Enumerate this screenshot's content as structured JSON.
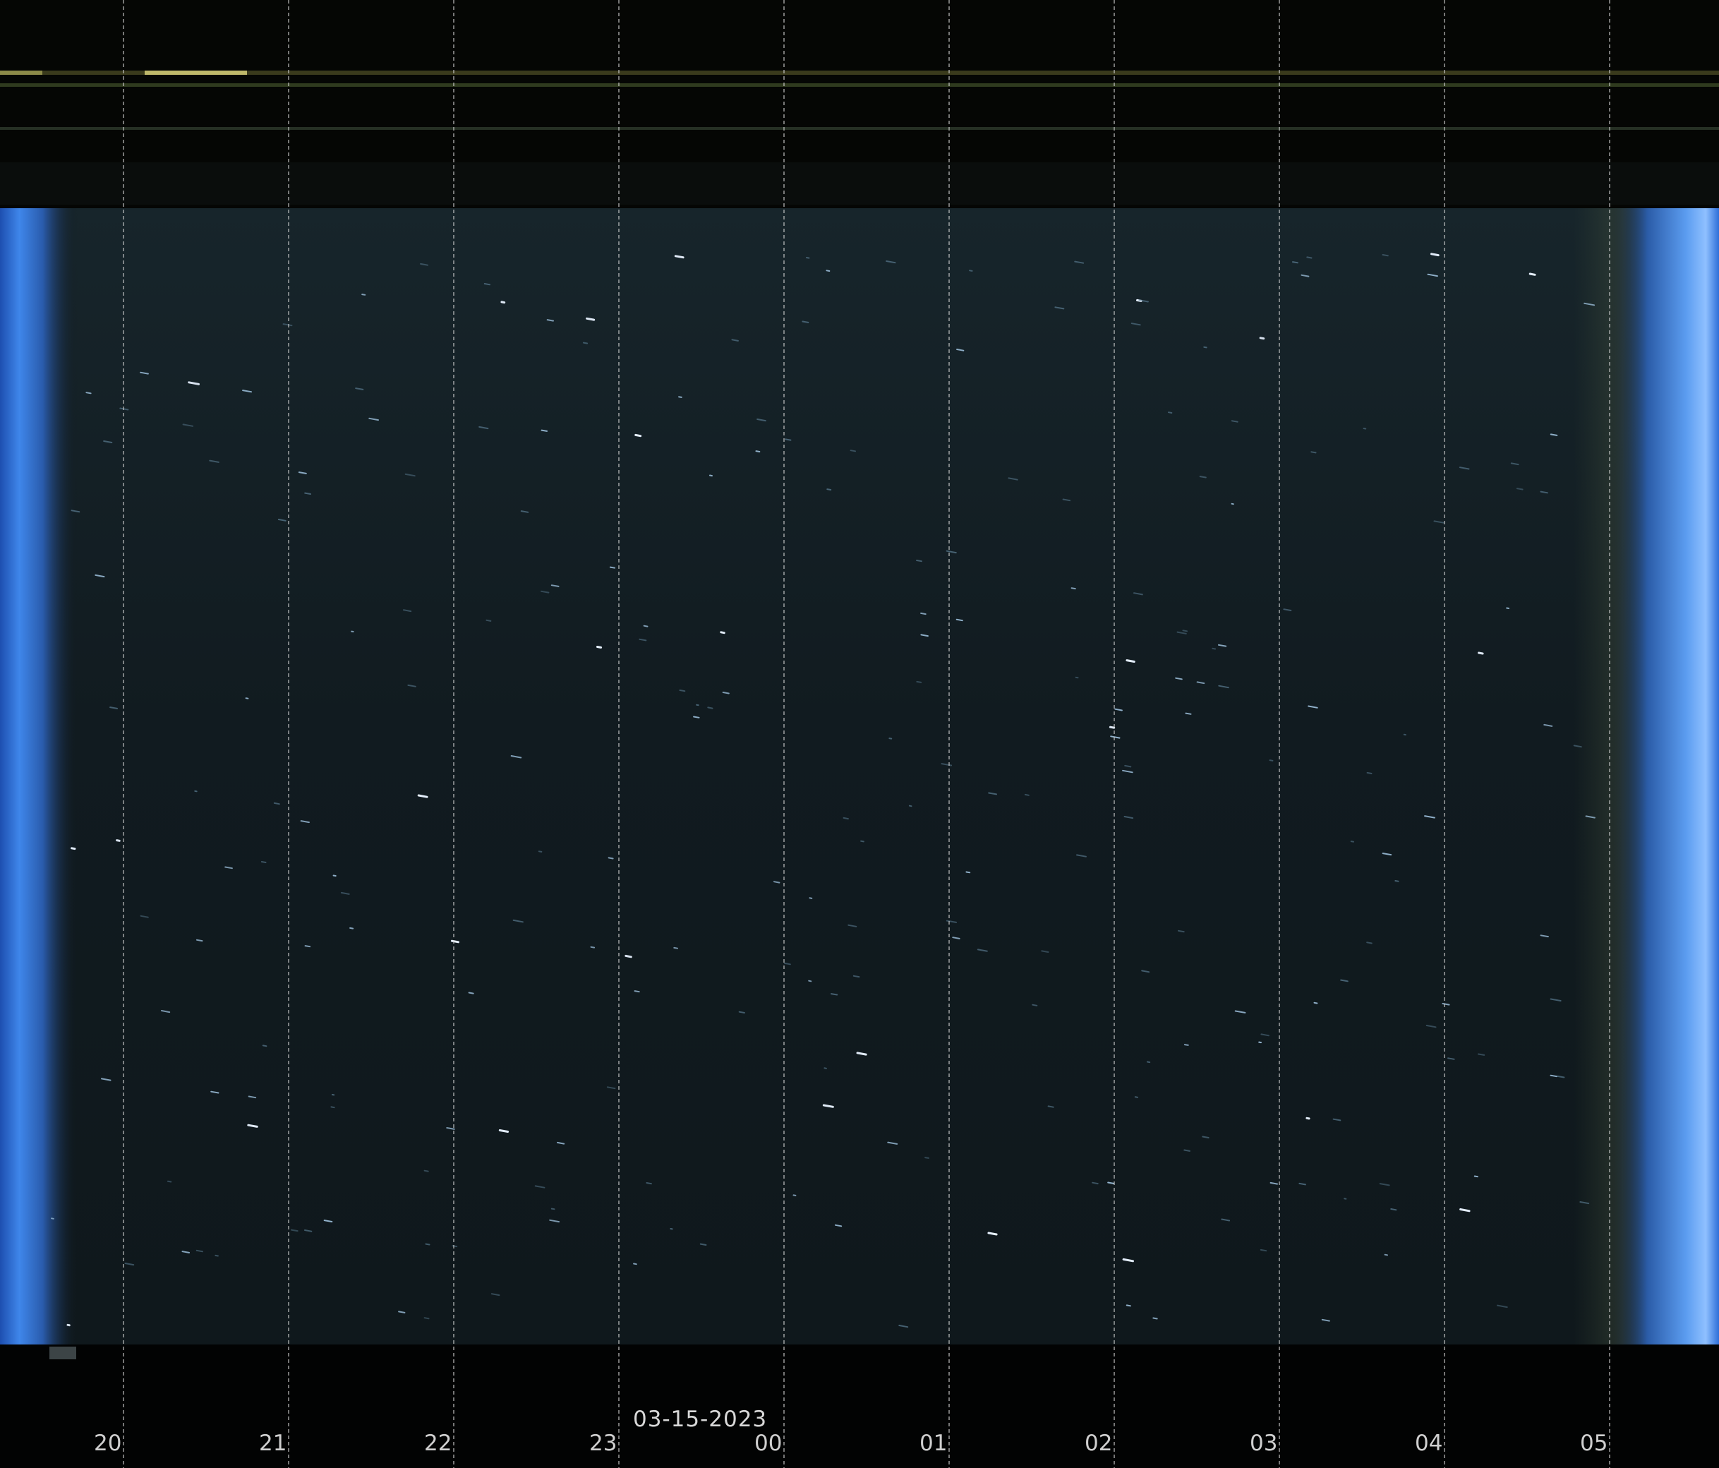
{
  "date": "03-15-2023",
  "hours": [
    "20",
    "21",
    "22",
    "23",
    "00",
    "01",
    "02",
    "03",
    "04",
    "05"
  ],
  "colors": {
    "sky": "#10181c",
    "edge_blue": "#3a7fe0",
    "grid_line": "#d0d0d0",
    "label": "#d0d0d0"
  }
}
